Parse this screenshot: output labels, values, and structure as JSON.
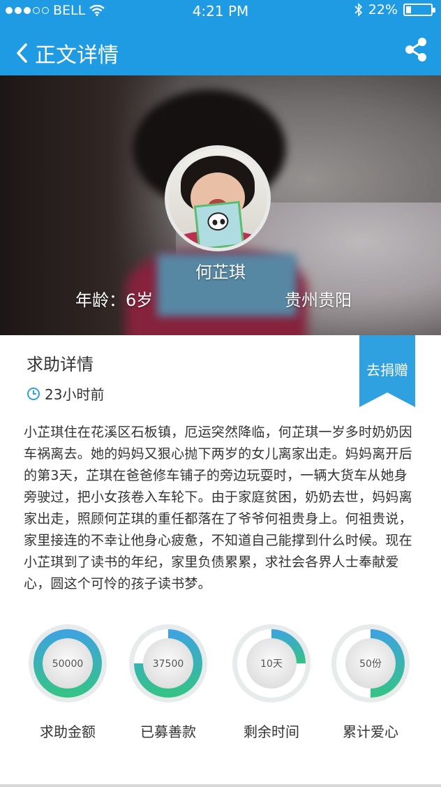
{
  "status_bar": {
    "carrier": "BELL",
    "time": "4:21 PM",
    "battery": "22%",
    "battery_level": 0.22
  },
  "nav": {
    "title": "正文详情",
    "back_icon": "chevron-left-icon",
    "share_icon": "share-icon"
  },
  "profile": {
    "name": "何芷琪",
    "age": "年龄：6岁",
    "location": "贵州贵阳"
  },
  "detail": {
    "section_title": "求助详情",
    "time_ago": "23小时前",
    "donate_label": "去捐赠",
    "story": "小芷琪住在花溪区石板镇，厄运突然降临，何芷琪一岁多时奶奶因车祸离去。她的妈妈又狠心抛下两岁的女儿离家出走。妈妈离开后的第3天，芷琪在爸爸修车铺子的旁边玩耍时，一辆大货车从她身旁驶过，把小女孩卷入车轮下。由于家庭贫困，奶奶去世，妈妈离家出走，照顾何芷琪的重任都落在了爷爷何祖贵身上。何祖贵说，家里接连的不幸让他身心疲惫，不知道自己能撑到什么时候。现在小芷琪到了读书的年纪，家里负债累累，求社会各界人士奉献爱心，圆这个可怜的孩子读书梦。"
  },
  "stats": [
    {
      "value": "50000",
      "label": "求助金额",
      "fraction": 1.0
    },
    {
      "value": "37500",
      "label": "已募善款",
      "fraction": 0.75
    },
    {
      "value": "10天",
      "label": "剩余时间",
      "fraction": 0.25
    },
    {
      "value": "50份",
      "label": "累计爱心",
      "fraction": 0.5
    }
  ],
  "colors": {
    "nav_bg": "#1f9be3",
    "accent": "#2fa0e0",
    "ring_start": "#3ea2e2",
    "ring_end": "#35c483",
    "ring_track": "#e7ebec"
  }
}
